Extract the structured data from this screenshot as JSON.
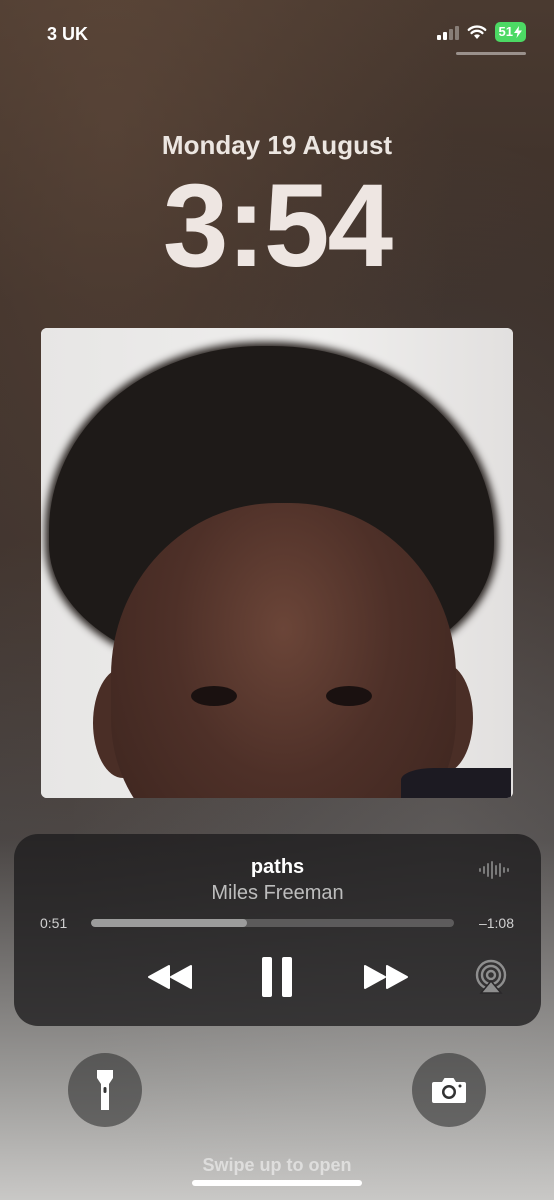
{
  "status_bar": {
    "carrier": "3 UK",
    "battery": "51",
    "wifi_icon": "wifi-icon",
    "signal_icon": "cellular-signal-icon",
    "battery_color": "#4cd964"
  },
  "lock_screen": {
    "date": "Monday 19 August",
    "time": "3:54",
    "swipe_hint": "Swipe up to open"
  },
  "now_playing": {
    "title": "paths",
    "artist": "Miles Freeman",
    "elapsed": "0:51",
    "remaining": "–1:08",
    "progress": 0.43,
    "controls": {
      "rewind_icon": "rewind-icon",
      "pause_icon": "pause-icon",
      "forward_icon": "fast-forward-icon",
      "airplay_icon": "airplay-icon",
      "waveform_icon": "waveform-icon"
    }
  },
  "quick_actions": {
    "flashlight_icon": "flashlight-icon",
    "camera_icon": "camera-icon"
  }
}
